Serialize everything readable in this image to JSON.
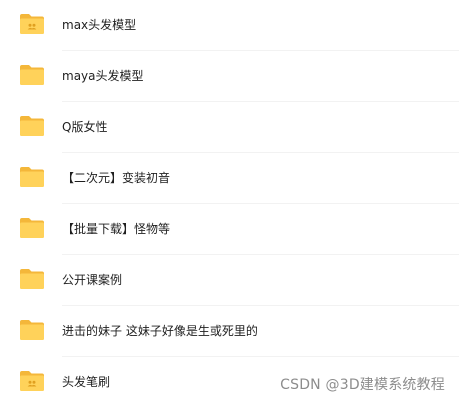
{
  "colors": {
    "folder_back": "#F4B73A",
    "folder_front": "#FFD25A",
    "folder_badge": "#E0A020",
    "row_divider": "#F2F2F2"
  },
  "files": [
    {
      "name": "max头发模型",
      "icon": "shared-folder-icon"
    },
    {
      "name": "maya头发模型",
      "icon": "folder-icon"
    },
    {
      "name": "Q版女性",
      "icon": "folder-icon"
    },
    {
      "name": "【二次元】变装初音",
      "icon": "folder-icon"
    },
    {
      "name": "【批量下载】怪物等",
      "icon": "folder-icon"
    },
    {
      "name": "公开课案例",
      "icon": "folder-icon"
    },
    {
      "name": "进击的妹子 这妹子好像是生或死里的",
      "icon": "folder-icon"
    },
    {
      "name": "头发笔刷",
      "icon": "shared-folder-icon"
    }
  ],
  "watermark": "CSDN @3D建模系统教程"
}
